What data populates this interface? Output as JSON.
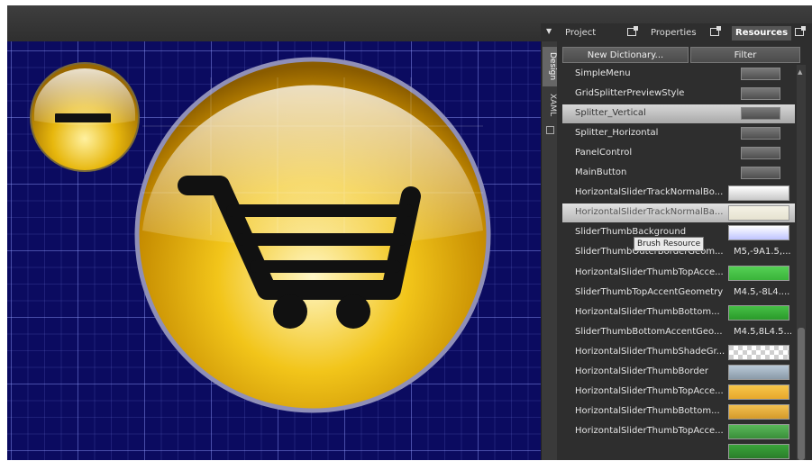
{
  "panel": {
    "tabs": [
      "Project",
      "Properties",
      "Resources"
    ],
    "side_tabs": [
      "Design",
      "XAML"
    ],
    "toolbar": {
      "new_dictionary": "New Dictionary...",
      "filter": "Filter"
    }
  },
  "resources": [
    {
      "name": "SimpleMenu",
      "preview": "button"
    },
    {
      "name": "GridSplitterPreviewStyle",
      "preview": "button"
    },
    {
      "name": "Splitter_Vertical",
      "preview": "button",
      "selected": true
    },
    {
      "name": "Splitter_Horizontal",
      "preview": "button"
    },
    {
      "name": "PanelControl",
      "preview": "button"
    },
    {
      "name": "MainButton",
      "preview": "button"
    },
    {
      "name": "HorizontalSliderTrackNormalBo...",
      "preview": "swatch",
      "colors": [
        "#ffffff",
        "#c8c8c8"
      ]
    },
    {
      "name": "HorizontalSliderTrackNormalBa...",
      "preview": "swatch",
      "colors": [
        "#f4f2e6",
        "#e6e2d0"
      ],
      "selected": true
    },
    {
      "name": "SliderThumbBackground",
      "preview": "swatch",
      "colors": [
        "#ffffff",
        "#bfc4ff"
      ]
    },
    {
      "name": "SliderThumbOuterBorderGeom...",
      "preview": "text",
      "value": "M5,-9A1.5,..."
    },
    {
      "name": "HorizontalSliderThumbTopAcce...",
      "preview": "swatch",
      "colors": [
        "#55d055",
        "#3ab43a"
      ]
    },
    {
      "name": "SliderThumbTopAccentGeometry",
      "preview": "text",
      "value": "M4.5,-8L4...."
    },
    {
      "name": "HorizontalSliderThumbBottom...",
      "preview": "swatch",
      "colors": [
        "#46c046",
        "#2a9a2a"
      ]
    },
    {
      "name": "SliderThumbBottomAccentGeo...",
      "preview": "text",
      "value": "M4.5,8L4.5..."
    },
    {
      "name": "HorizontalSliderThumbShadeGr...",
      "preview": "checker"
    },
    {
      "name": "HorizontalSliderThumbBorder",
      "preview": "swatch",
      "colors": [
        "#b9c9d8",
        "#8a9aa8"
      ]
    },
    {
      "name": "HorizontalSliderThumbTopAcce...",
      "preview": "swatch",
      "colors": [
        "#f6c64a",
        "#e8a82c"
      ]
    },
    {
      "name": "HorizontalSliderThumbBottom...",
      "preview": "swatch",
      "colors": [
        "#f2c050",
        "#d49a2a"
      ]
    },
    {
      "name": "HorizontalSliderThumbTopAcce...",
      "preview": "swatch",
      "colors": [
        "#59b859",
        "#3a8f3a"
      ]
    },
    {
      "name": "",
      "preview": "swatch",
      "colors": [
        "#3aa43a",
        "#2a7e2a"
      ]
    }
  ],
  "tooltip": "Brush Resource",
  "icons": {
    "large_button": "shopping-cart-icon",
    "small_button": "minus-icon"
  },
  "colors": {
    "canvas": "#0b0b60",
    "button_gold": "#e6b800"
  }
}
